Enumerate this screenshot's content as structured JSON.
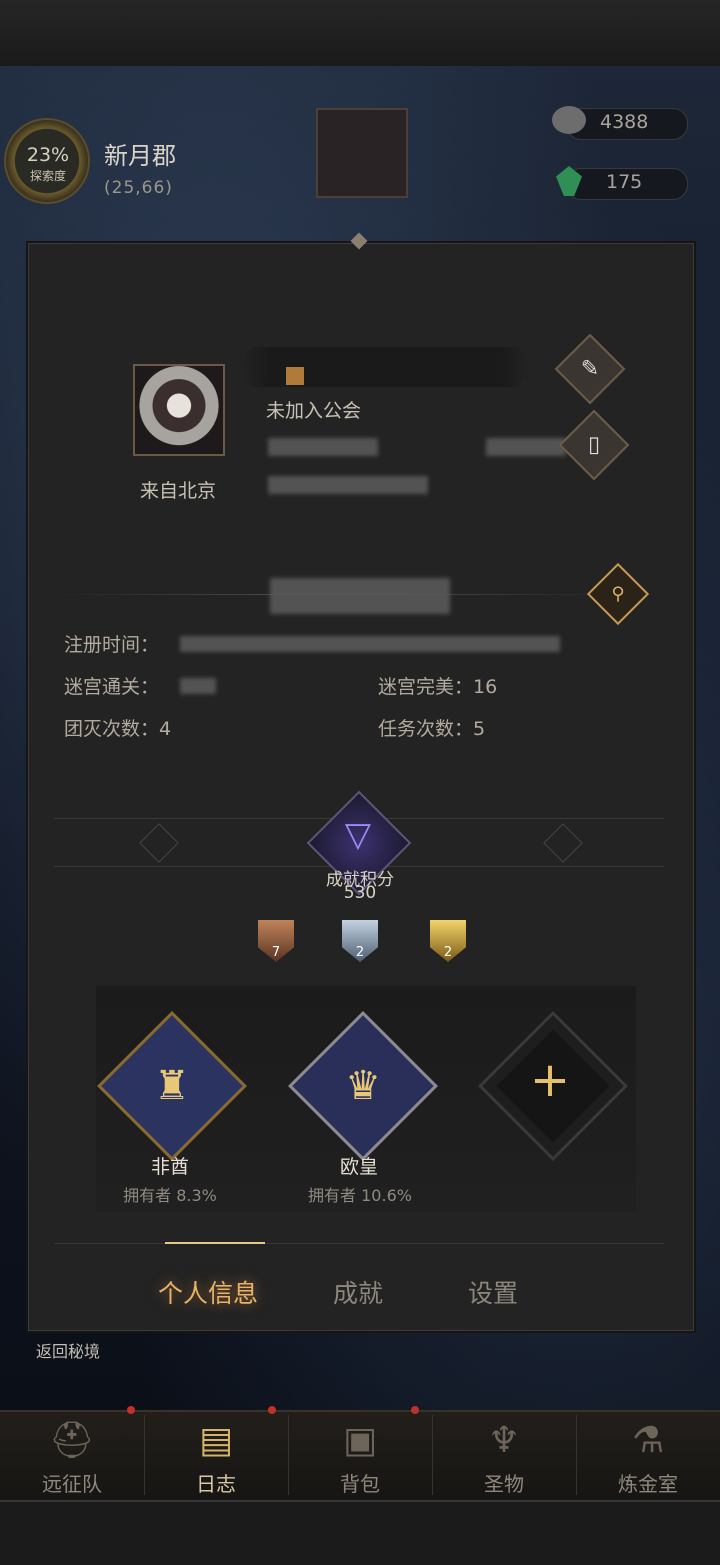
{
  "hud": {
    "explore_percent": "23%",
    "explore_label": "探索度",
    "area_name": "新月郡",
    "area_coord": "(25,66)",
    "stone_count": "4388",
    "gem_count": "175"
  },
  "profile": {
    "guild": "未加入公会",
    "origin": "来自北京"
  },
  "records": {
    "register_label": "注册时间：",
    "maze_clear_label": "迷宫通关：",
    "maze_perfect": "迷宫完美：16",
    "team_wipes": "团灭次数：4",
    "missions": "任务次数：5"
  },
  "achievement": {
    "label": "成就积分",
    "score": "530",
    "medals": [
      {
        "tier": "bronze",
        "count": "7"
      },
      {
        "tier": "silver",
        "count": "2"
      },
      {
        "tier": "gold",
        "count": "2"
      }
    ],
    "badges": [
      {
        "name": "非酋",
        "owners": "拥有者 8.3%"
      },
      {
        "name": "欧皇",
        "owners": "拥有者 10.6%"
      }
    ]
  },
  "tabs": {
    "profile": "个人信息",
    "achievements": "成就",
    "settings": "设置"
  },
  "return_label": "返回秘境",
  "nav": {
    "expedition": "远征队",
    "journal": "日志",
    "backpack": "背包",
    "relic": "圣物",
    "alchemy": "炼金室"
  },
  "colors": {
    "active_tab": "#e7b26a",
    "panel_bg": "#232323",
    "gold_accent": "#e6c06a"
  }
}
